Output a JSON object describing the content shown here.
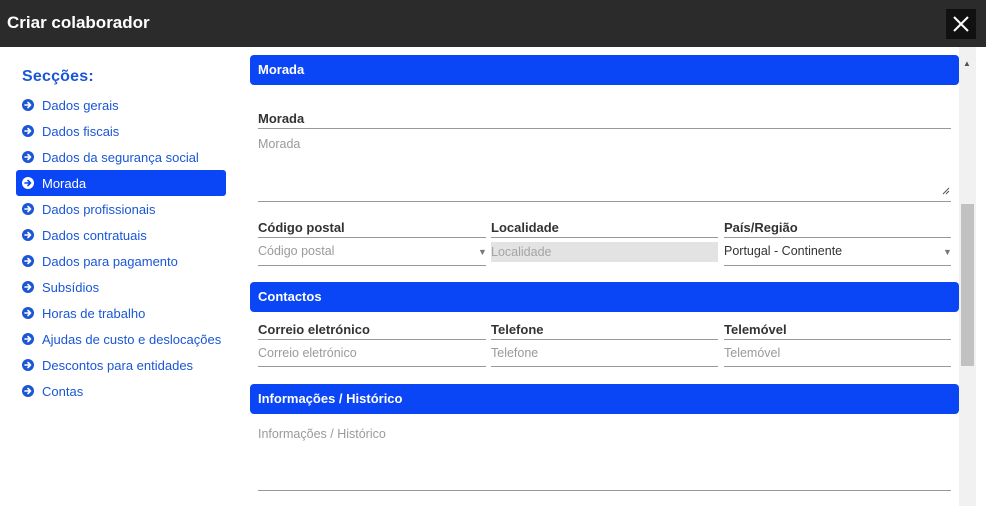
{
  "dialog": {
    "title": "Criar colaborador"
  },
  "sidebar": {
    "heading": "Secções:",
    "items": [
      {
        "label": "Dados gerais"
      },
      {
        "label": "Dados fiscais"
      },
      {
        "label": "Dados da segurança social"
      },
      {
        "label": "Morada"
      },
      {
        "label": "Dados profissionais"
      },
      {
        "label": "Dados contratuais"
      },
      {
        "label": "Dados para pagamento"
      },
      {
        "label": "Subsídios"
      },
      {
        "label": "Horas de trabalho"
      },
      {
        "label": "Ajudas de custo e deslocações"
      },
      {
        "label": "Descontos para entidades"
      },
      {
        "label": "Contas"
      }
    ],
    "active_index": 3
  },
  "morada": {
    "header": "Morada",
    "address_label": "Morada",
    "address_placeholder": "Morada",
    "postal_label": "Código postal",
    "postal_placeholder": "Código postal",
    "locality_label": "Localidade",
    "locality_placeholder": "Localidade",
    "country_label": "País/Região",
    "country_value": "Portugal - Continente"
  },
  "contactos": {
    "header": "Contactos",
    "email_label": "Correio eletrónico",
    "email_placeholder": "Correio eletrónico",
    "phone_label": "Telefone",
    "phone_placeholder": "Telefone",
    "mobile_label": "Telemóvel",
    "mobile_placeholder": "Telemóvel"
  },
  "info": {
    "header": "Informações / Histórico",
    "placeholder": "Informações / Histórico"
  },
  "colors": {
    "accent": "#0a46f5",
    "link": "#1a56d6",
    "titlebar": "#2b2b2b"
  },
  "icons": {
    "close": "close-icon",
    "nav": "arrow-circle-right-icon",
    "scroll_up": "scroll-up-arrow-icon"
  }
}
